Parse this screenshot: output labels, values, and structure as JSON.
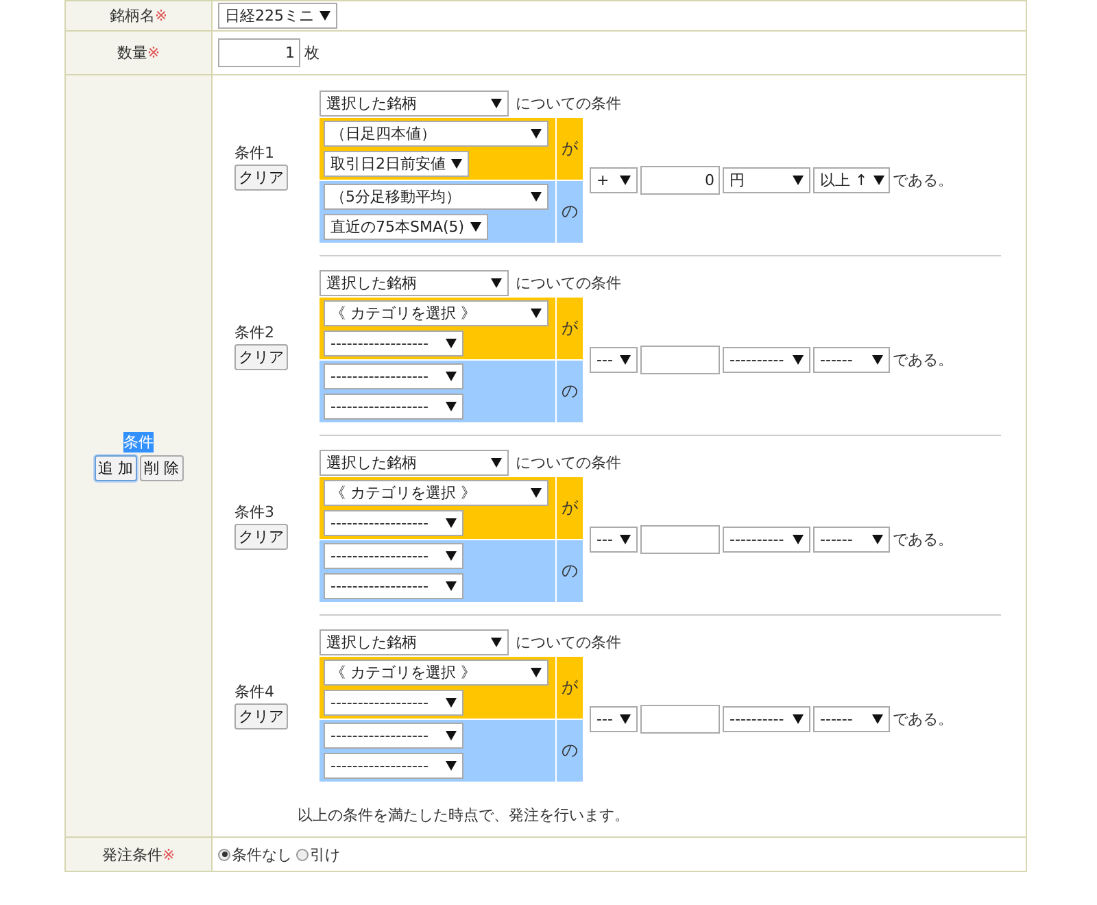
{
  "form_rows_top": [
    {
      "label": "銘柄名",
      "required_mark": "※",
      "select": "日経225ミニ"
    },
    {
      "label": "数量",
      "required_mark": "※",
      "value": "1",
      "unit": "枚"
    }
  ],
  "conditions_row": {
    "label": "条件",
    "add_button": "追 加",
    "delete_button": "削 除",
    "conditions": [
      {
        "label": "条件1",
        "clear_button": "クリア",
        "subject": "選択した銘柄",
        "subject_suffix": "についての条件",
        "ga_label": "が",
        "no_label": "の",
        "ga_selects": [
          {
            "kind": "category",
            "text": "（日足四本値）"
          },
          {
            "kind": "item",
            "text": "取引日2日前安値"
          }
        ],
        "no_selects": [
          {
            "kind": "category",
            "text": "（5分足移動平均）"
          },
          {
            "kind": "item",
            "text": "直近の75本SMA(5)"
          }
        ],
        "operator": "+",
        "value": "0",
        "unit": "円",
        "direction": "以上 ↑",
        "tail": "である。"
      },
      {
        "label": "条件2",
        "clear_button": "クリア",
        "subject": "選択した銘柄",
        "subject_suffix": "についての条件",
        "ga_label": "が",
        "no_label": "の",
        "ga_selects": [
          {
            "kind": "category",
            "text": "《 カテゴリを選択 》"
          },
          {
            "kind": "item",
            "text": "------------------"
          }
        ],
        "no_selects": [
          {
            "kind": "item",
            "text": "------------------"
          },
          {
            "kind": "item",
            "text": "------------------"
          }
        ],
        "operator": "---",
        "unit": "----------",
        "direction": "------",
        "tail": "である。"
      },
      {
        "label": "条件3",
        "clear_button": "クリア",
        "subject": "選択した銘柄",
        "subject_suffix": "についての条件",
        "ga_label": "が",
        "no_label": "の",
        "ga_selects": [
          {
            "kind": "category",
            "text": "《 カテゴリを選択 》"
          },
          {
            "kind": "item",
            "text": "------------------"
          }
        ],
        "no_selects": [
          {
            "kind": "item",
            "text": "------------------"
          },
          {
            "kind": "item",
            "text": "------------------"
          }
        ],
        "operator": "---",
        "unit": "----------",
        "direction": "------",
        "tail": "である。"
      },
      {
        "label": "条件4",
        "clear_button": "クリア",
        "subject": "選択した銘柄",
        "subject_suffix": "についての条件",
        "ga_label": "が",
        "no_label": "の",
        "ga_selects": [
          {
            "kind": "category",
            "text": "《 カテゴリを選択 》"
          },
          {
            "kind": "item",
            "text": "------------------"
          }
        ],
        "no_selects": [
          {
            "kind": "item",
            "text": "------------------"
          },
          {
            "kind": "item",
            "text": "------------------"
          }
        ],
        "operator": "---",
        "unit": "----------",
        "direction": "------",
        "tail": "である。"
      }
    ],
    "note": "以上の条件を満たした時点で、発注を行います。"
  },
  "order_condition": {
    "label": "発注条件",
    "required_mark": "※",
    "options": [
      {
        "label": "条件なし",
        "selected": true
      },
      {
        "label": "引け",
        "selected": false
      }
    ]
  }
}
